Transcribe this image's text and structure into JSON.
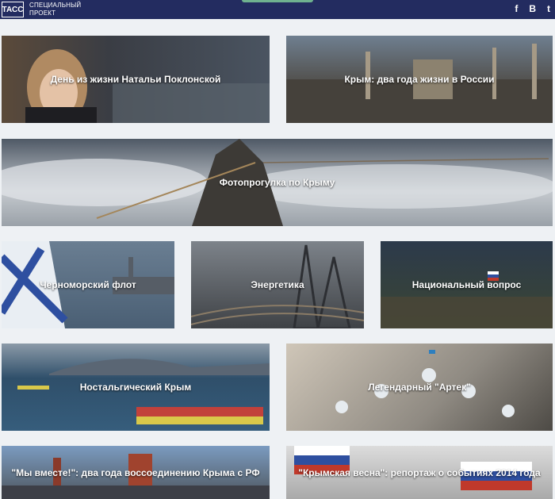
{
  "header": {
    "logo": "ТАСС",
    "project_line1": "СПЕЦИАЛЬНЫЙ",
    "project_line2": "ПРОЕКТ",
    "social": [
      "f",
      "В",
      "t"
    ]
  },
  "tiles": [
    "День из жизни Натальи Поклонской",
    "Крым: два года жизни в России",
    "Фотопрогулка по Крыму",
    "Черноморский флот",
    "Энергетика",
    "Национальный вопрос",
    "Ностальгический Крым",
    "Легендарный \"Артек\"",
    "\"Мы вместе!\": два года воссоединению Крыма с РФ",
    "\"Крымская весна\": репортаж о событиях 2014 года"
  ]
}
